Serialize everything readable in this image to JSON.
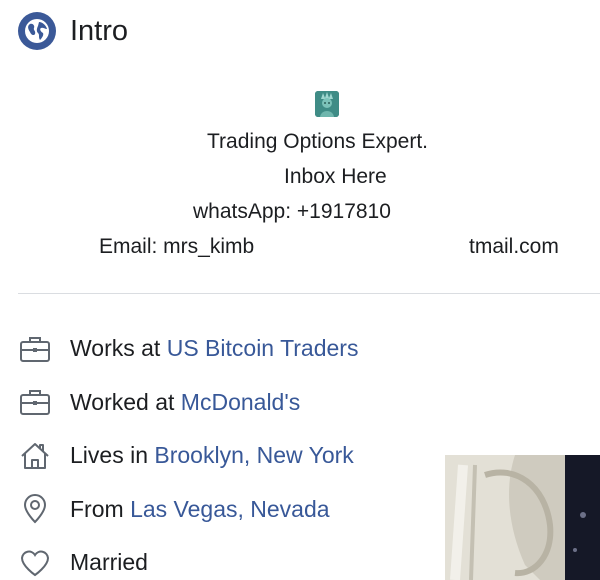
{
  "header": {
    "title": "Intro",
    "icon": "globe-icon"
  },
  "bio": {
    "emoji": "statue-of-liberty-emoji",
    "line1": "Trading Options Expert.",
    "line2": "Inbox Here",
    "line3": "whatsApp: +1917810",
    "line4_left": "Email: mrs_kimb",
    "line4_right": "tmail.com"
  },
  "details": [
    {
      "icon": "briefcase-icon",
      "prefix": "Works at ",
      "link": "US Bitcoin Traders"
    },
    {
      "icon": "briefcase-icon",
      "prefix": "Worked at ",
      "link": "McDonald's"
    },
    {
      "icon": "home-icon",
      "prefix": "Lives in ",
      "link": "Brooklyn, New York"
    },
    {
      "icon": "location-pin-icon",
      "prefix": "From ",
      "link": "Las Vegas, Nevada"
    },
    {
      "icon": "heart-icon",
      "prefix": "Married",
      "link": ""
    }
  ],
  "colors": {
    "accent": "#3b5998",
    "link": "#385898",
    "text": "#1c1e21",
    "icon": "#606770"
  }
}
